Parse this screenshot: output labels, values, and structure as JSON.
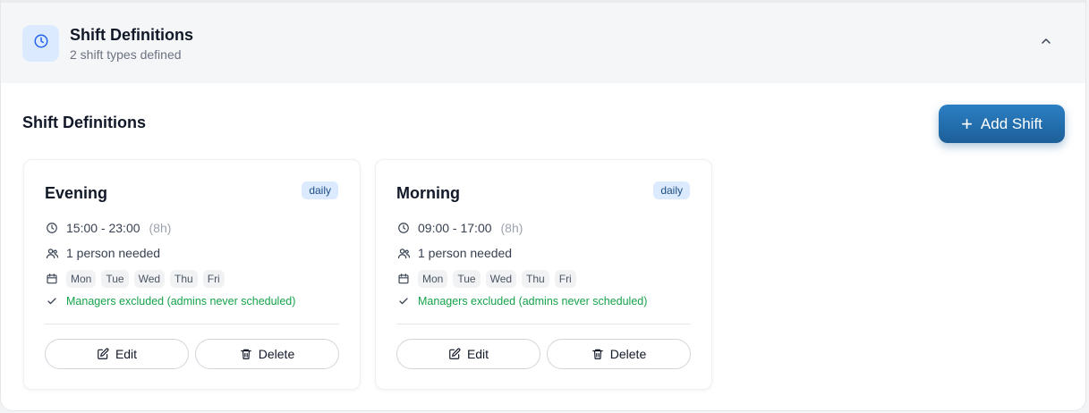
{
  "header": {
    "title": "Shift Definitions",
    "subtitle": "2 shift types defined"
  },
  "section": {
    "title": "Shift Definitions",
    "add_label": "Add Shift"
  },
  "shifts": [
    {
      "name": "Evening",
      "badge": "daily",
      "time": "15:00 - 23:00",
      "hours": "(8h)",
      "people": "1 person needed",
      "days": [
        "Mon",
        "Tue",
        "Wed",
        "Thu",
        "Fri"
      ],
      "note": "Managers excluded (admins never scheduled)",
      "edit_label": "Edit",
      "delete_label": "Delete"
    },
    {
      "name": "Morning",
      "badge": "daily",
      "time": "09:00 - 17:00",
      "hours": "(8h)",
      "people": "1 person needed",
      "days": [
        "Mon",
        "Tue",
        "Wed",
        "Thu",
        "Fri"
      ],
      "note": "Managers excluded (admins never scheduled)",
      "edit_label": "Edit",
      "delete_label": "Delete"
    }
  ],
  "colors": {
    "accent": "#1d5f98",
    "badge_bg": "#dbeafe",
    "success": "#16a34a"
  },
  "icons": {
    "header": "clock-icon",
    "collapse": "chevron-up-icon",
    "add": "plus-icon",
    "time": "clock-icon",
    "people": "users-icon",
    "days": "calendar-icon",
    "note": "check-icon",
    "edit": "edit-icon",
    "delete": "trash-icon"
  }
}
